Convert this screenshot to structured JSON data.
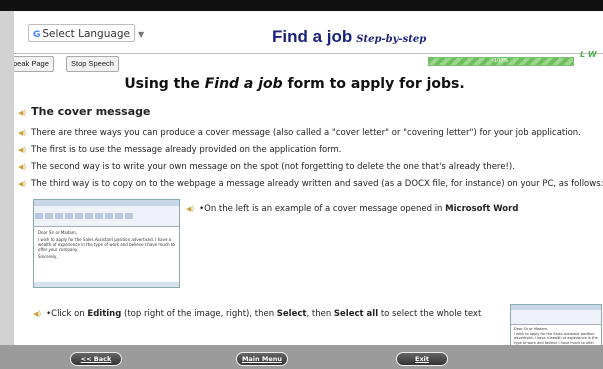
{
  "header": {
    "language_select": "Select Language",
    "title": "Find a job",
    "subtitle": "Step-by-step"
  },
  "toolbar": {
    "speak_label": "Speak Page",
    "stop_label": "Stop Speech"
  },
  "progress": {
    "percent_label": "100%",
    "value": 1.0,
    "side_text": "L W"
  },
  "content": {
    "heading_pre": "Using the ",
    "heading_em": "Find a job",
    "heading_post": " form to apply for jobs.",
    "section_title": "The cover message",
    "lines": [
      "There are three ways you can produce a cover message (also called a \"cover letter\" or \"covering letter\") for your job application.",
      "The first is to use the message already provided on the application form.",
      "The second way is to write your own message on the spot (not forgetting to delete the one that's already there!).",
      "The third way is to copy on to the webpage a message already written and saved (as a DOCX file, for instance) on your PC, as follows:"
    ],
    "example_pre": "•On the left is an example of a cover message opened in ",
    "example_bold": "Microsoft Word",
    "click_parts": {
      "p1": "•Click on ",
      "b1": "Editing",
      "p2": " (top right of the image, right), then ",
      "b2": "Select",
      "p3": ", then ",
      "b3": "Select all",
      "p4": " to select the whole text"
    },
    "word_doc_lines": [
      "Dear Sir or Madam,",
      "I wish to apply for the Sales Assistant position advertised. I have a wealth of experience in the type of work and believe I have much to offer your company.",
      "Sincerely,"
    ]
  },
  "nav": {
    "back": "<< Back",
    "main_menu": "Main Menu",
    "exit": "Exit"
  },
  "colors": {
    "title": "#1a237e",
    "speaker_icon": "#c9a23a",
    "progress": "#6fbe5e"
  },
  "icons": [
    "google-g-icon",
    "speaker-icon",
    "chevron-down-icon"
  ]
}
